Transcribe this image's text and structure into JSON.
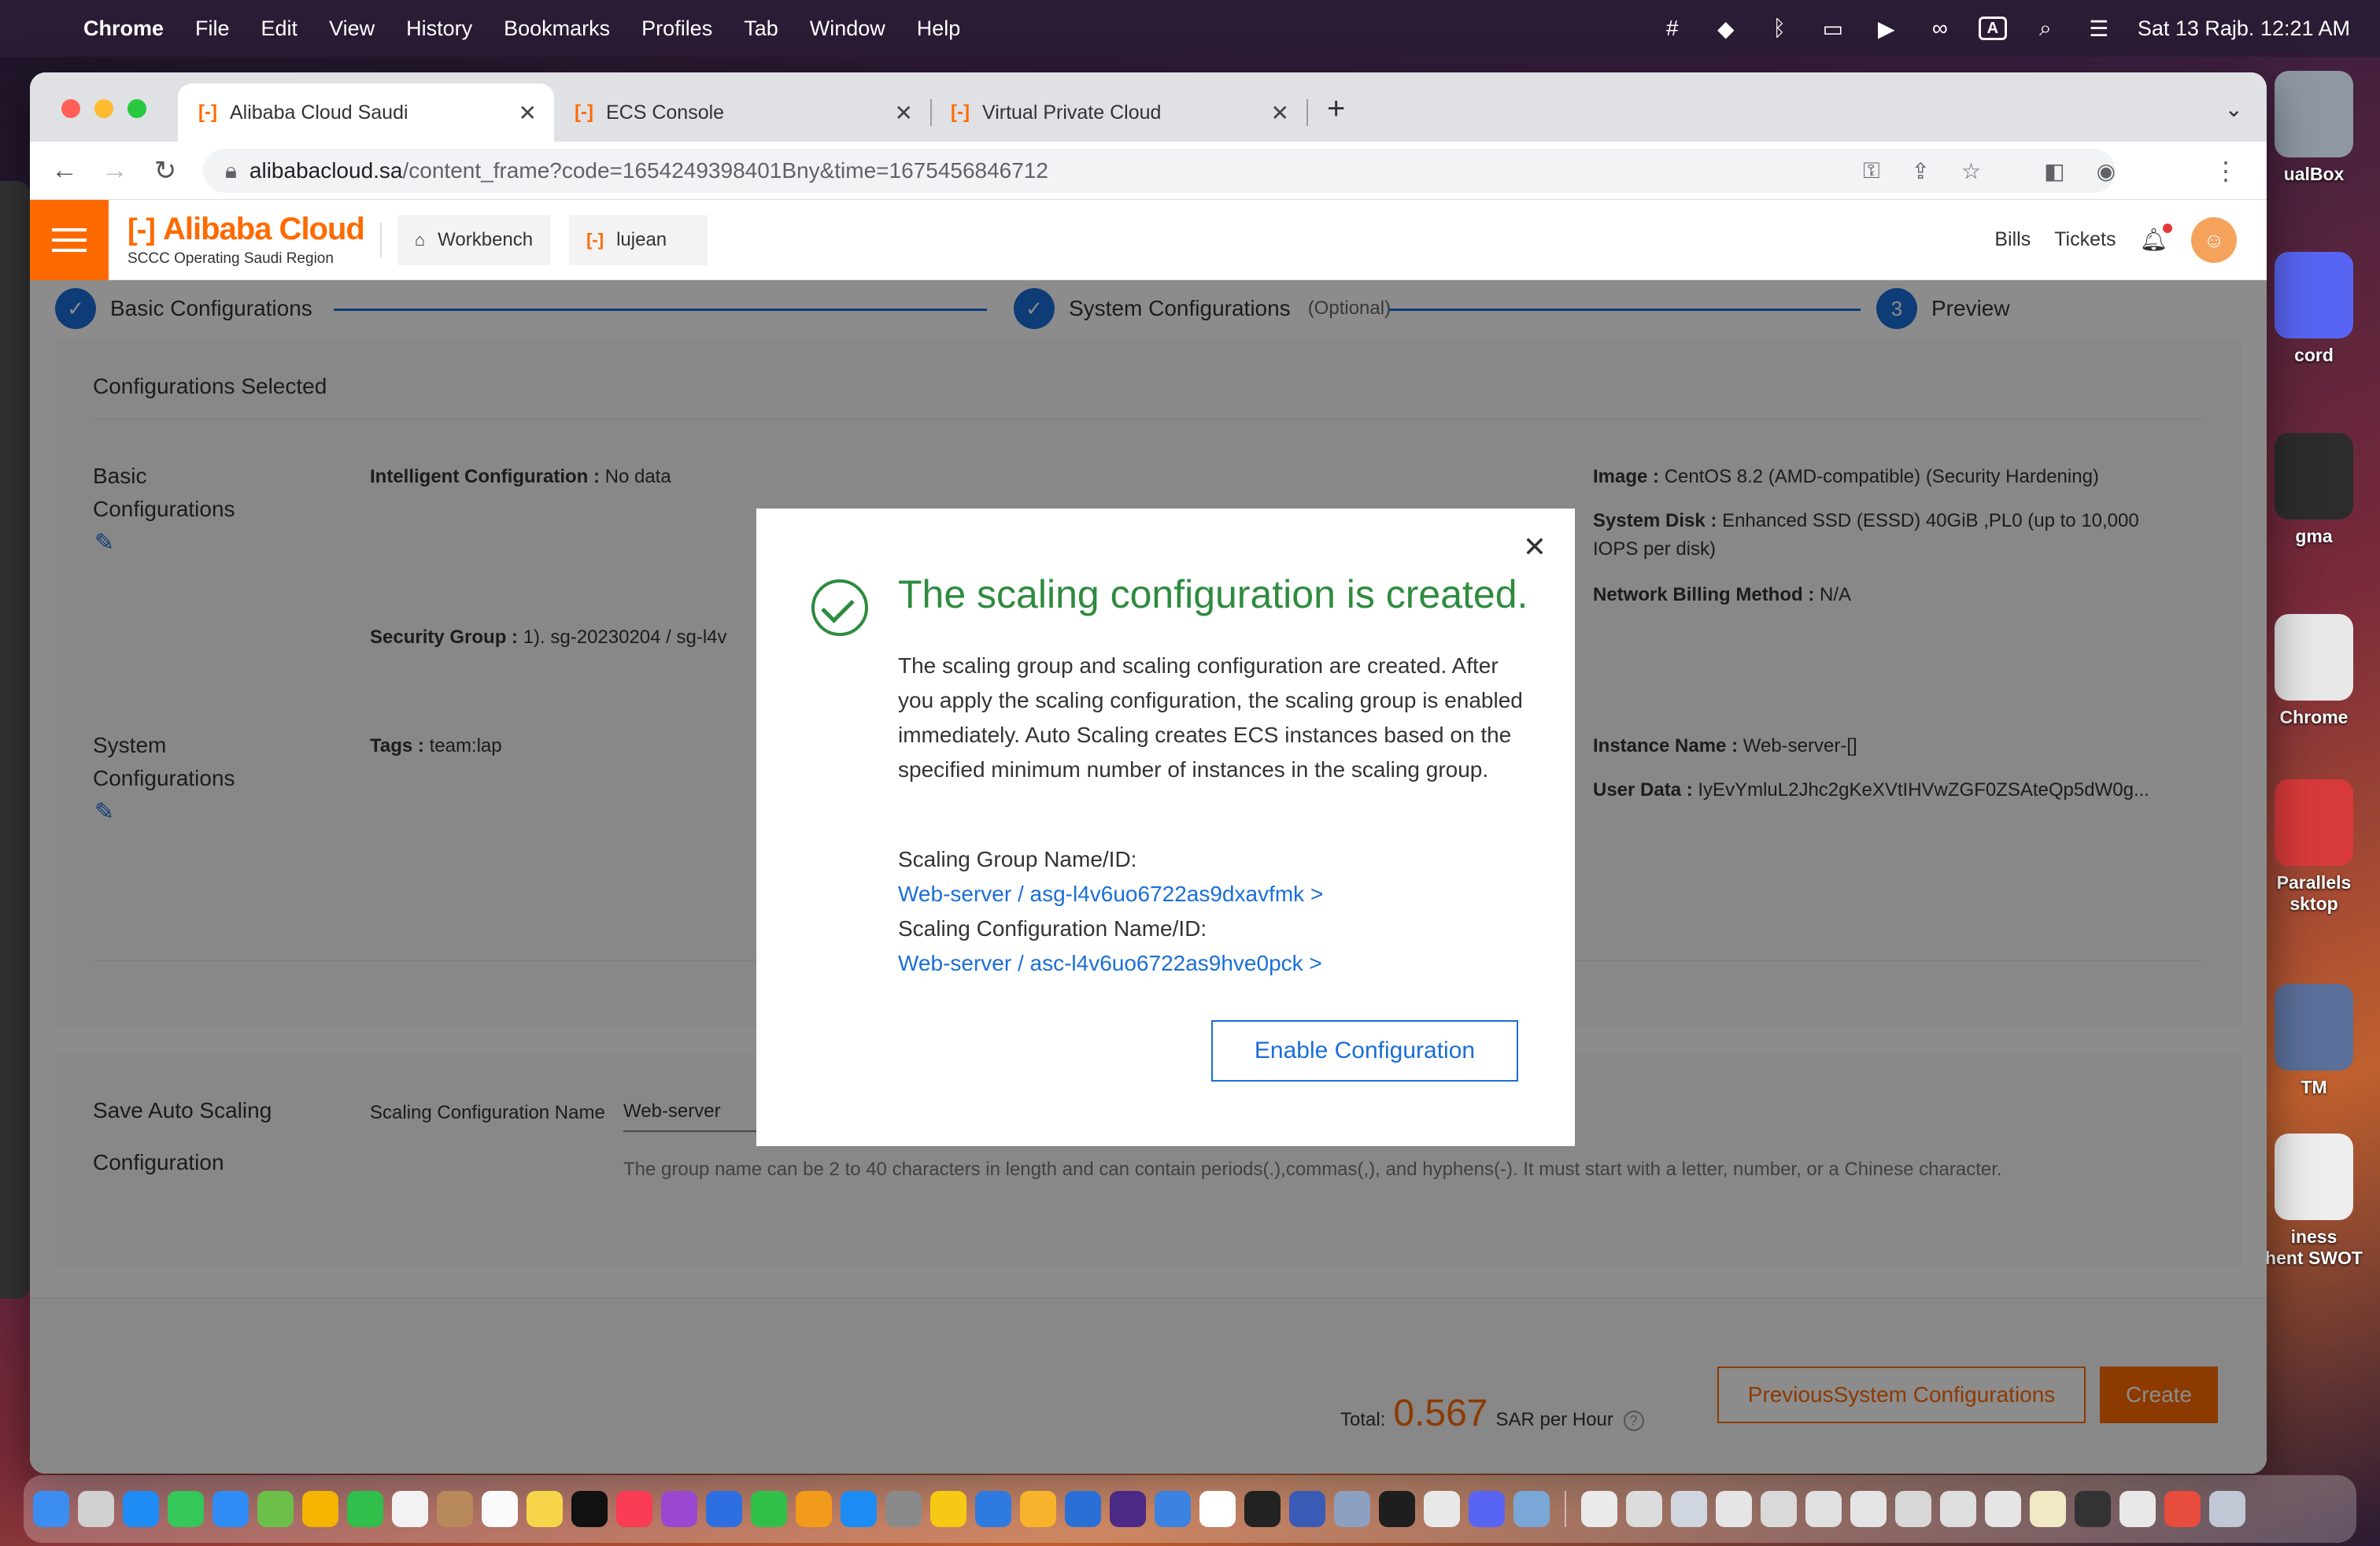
{
  "menubar": {
    "app": "Chrome",
    "items": [
      "File",
      "Edit",
      "View",
      "History",
      "Bookmarks",
      "Profiles",
      "Tab",
      "Window",
      "Help"
    ],
    "input_indicator": "A",
    "datetime": "Sat 13 Rajb.  12:21 AM"
  },
  "desktop": {
    "icons": [
      "ualBox",
      "cord",
      "gma",
      "Chrome",
      "Parallels\nsktop",
      "TM",
      "iness\nhent SWOT"
    ]
  },
  "browser": {
    "tabs": [
      {
        "title": "Alibaba Cloud Saudi"
      },
      {
        "title": "ECS Console"
      },
      {
        "title": "Virtual Private Cloud"
      }
    ],
    "url_host": "alibabacloud.sa",
    "url_path": "/content_frame?code=1654249398401Bny&time=1675456846712"
  },
  "header": {
    "brand": "Alibaba Cloud",
    "region": "SCCC Operating Saudi Region",
    "workbench": "Workbench",
    "user": "lujean",
    "bills": "Bills",
    "tickets": "Tickets"
  },
  "steps": {
    "step1": "Basic Configurations",
    "step2": "System Configurations",
    "step2_note": "(Optional)",
    "step3_num": "3",
    "step3": "Preview"
  },
  "config": {
    "heading": "Configurations Selected",
    "basic_label": "Basic Configurations",
    "intelligent_key": "Intelligent Configuration :",
    "intelligent_val": "No data",
    "security_key": "Security Group :",
    "security_val": "1). sg-20230204 / sg-l4v",
    "image_key": "Image :",
    "image_val": "CentOS 8.2 (AMD-compatible)  (Security Hardening)",
    "disk_key": "System Disk :",
    "disk_val": "Enhanced SSD (ESSD) 40GiB ,PL0 (up to 10,000 IOPS per disk)",
    "billing_key": "Network Billing Method :",
    "billing_val": "N/A",
    "system_label": "System Configurations",
    "tags_key": "Tags :",
    "tags_val": "team:lap",
    "instance_key": "Instance Name :",
    "instance_val": "Web-server-[]",
    "userdata_key": "User Data :",
    "userdata_val": "IyEvYmluL2Jhc2gKeXVtIHVwZGF0ZSAteQp5dW0g..."
  },
  "save": {
    "label1": "Save Auto Scaling",
    "label2": "Configuration",
    "name_key": "Scaling Configuration Name",
    "name_val": "Web-server",
    "hint": "The group name can be 2 to 40 characters in length and can contain periods(.),commas(,), and hyphens(-). It must start with a letter, number, or a Chinese character."
  },
  "footer": {
    "total_label": "Total:",
    "amount": "0.567",
    "unit": "SAR per Hour",
    "prev_btn": "PreviousSystem Configurations",
    "create_btn": "Create"
  },
  "modal": {
    "title": "The scaling configuration is created.",
    "body": "The scaling group and scaling configuration are created. After you apply the scaling configuration, the scaling group is enabled immediately. Auto Scaling creates ECS instances based on the specified minimum number of instances in the scaling group.",
    "group_label": "Scaling Group Name/ID:",
    "group_link": "Web-server / asg-l4v6uo6722as9dxavfmk >",
    "config_label": "Scaling Configuration Name/ID:",
    "config_link": "Web-server / asc-l4v6uo6722as9hve0pck >",
    "enable_btn": "Enable Configuration"
  },
  "colors": {
    "brand": "#ff6a00",
    "link": "#1a6ed8",
    "success": "#2e8b3e"
  }
}
